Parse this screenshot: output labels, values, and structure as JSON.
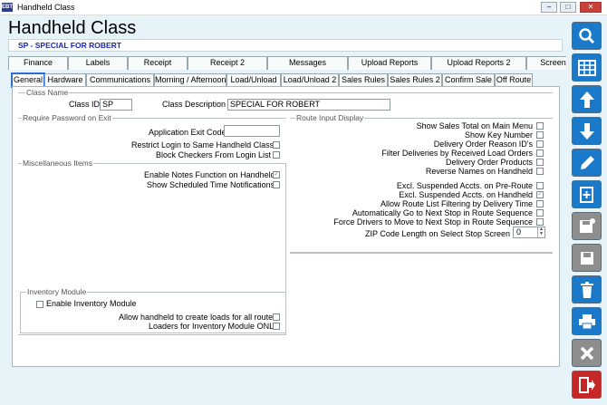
{
  "window": {
    "title": "Handheld Class",
    "icon_label": "EBT"
  },
  "header": {
    "title": "Handheld Class",
    "record": "SP - SPECIAL FOR ROBERT"
  },
  "tabs_top": [
    "Finance",
    "Labels",
    "Receipt",
    "Receipt 2",
    "Messages",
    "Upload Reports",
    "Upload Reports 2",
    "Screen"
  ],
  "tabs_bottom": [
    "General",
    "Hardware",
    "Communications",
    "Morning / Afternoon",
    "Load/Unload",
    "Load/Unload 2",
    "Sales Rules",
    "Sales Rules 2",
    "Confirm Sale",
    "Off Route"
  ],
  "active_tab": "General",
  "class_name": {
    "legend": "Class Name",
    "id_label": "Class ID",
    "id_value": "SP",
    "desc_label": "Class Description",
    "desc_value": "SPECIAL FOR  ROBERT"
  },
  "require_password": {
    "legend": "Require Password on Exit",
    "exit_code_label": "Application Exit Code",
    "exit_code_value": "",
    "restrict_label": "Restrict Login to Same Handheld Class",
    "restrict_checked": false,
    "block_label": "Block Checkers From Login List",
    "block_checked": false
  },
  "misc": {
    "legend": "Miscellaneous Items",
    "notes_label": "Enable Notes Function on Handheld",
    "notes_checked": true,
    "sched_label": "Show Scheduled Time Notifications",
    "sched_checked": false
  },
  "inventory": {
    "legend": "Inventory Module",
    "enable_label": "Enable Inventory Module",
    "enable_checked": false,
    "allow_label": "Allow handheld to create loads for all routes",
    "allow_checked": false,
    "loaders_label": "Loaders for Inventory Module ONLY",
    "loaders_checked": false
  },
  "route_input": {
    "legend": "Route Input Display",
    "items": [
      {
        "label": "Show Sales Total on Main Menu",
        "checked": false
      },
      {
        "label": "Show Key Number",
        "checked": false
      },
      {
        "label": "Delivery Order Reason ID's",
        "checked": false
      },
      {
        "label": "Filter Deliveries by Received Load Orders",
        "checked": false
      },
      {
        "label": "Delivery Order Products",
        "checked": false
      },
      {
        "label": "Reverse Names on Handheld",
        "checked": false
      }
    ],
    "items2": [
      {
        "label": "Excl. Suspended Accts. on Pre-Route",
        "checked": false
      },
      {
        "label": "Excl. Suspended Accts. on Handheld",
        "checked": true
      },
      {
        "label": "Allow Route List Filtering by Delivery Time",
        "checked": false
      },
      {
        "label": "Automatically Go to Next Stop in Route Sequence",
        "checked": false
      },
      {
        "label": "Force Drivers to Move to Next Stop in Route Sequence",
        "checked": false
      }
    ],
    "zip_label": "ZIP Code Length on Select Stop Screen",
    "zip_value": "0"
  },
  "sidebar": [
    "search-icon",
    "grid-icon",
    "arrow-up-icon",
    "arrow-down-icon",
    "pencil-icon",
    "new-doc-icon",
    "save-as-icon",
    "save-icon",
    "trash-icon",
    "print-icon",
    "close-icon",
    "exit-icon"
  ],
  "colors": {
    "accent": "#1b79c9",
    "record_text": "#1a2aa8",
    "background": "#e6f4f9"
  }
}
